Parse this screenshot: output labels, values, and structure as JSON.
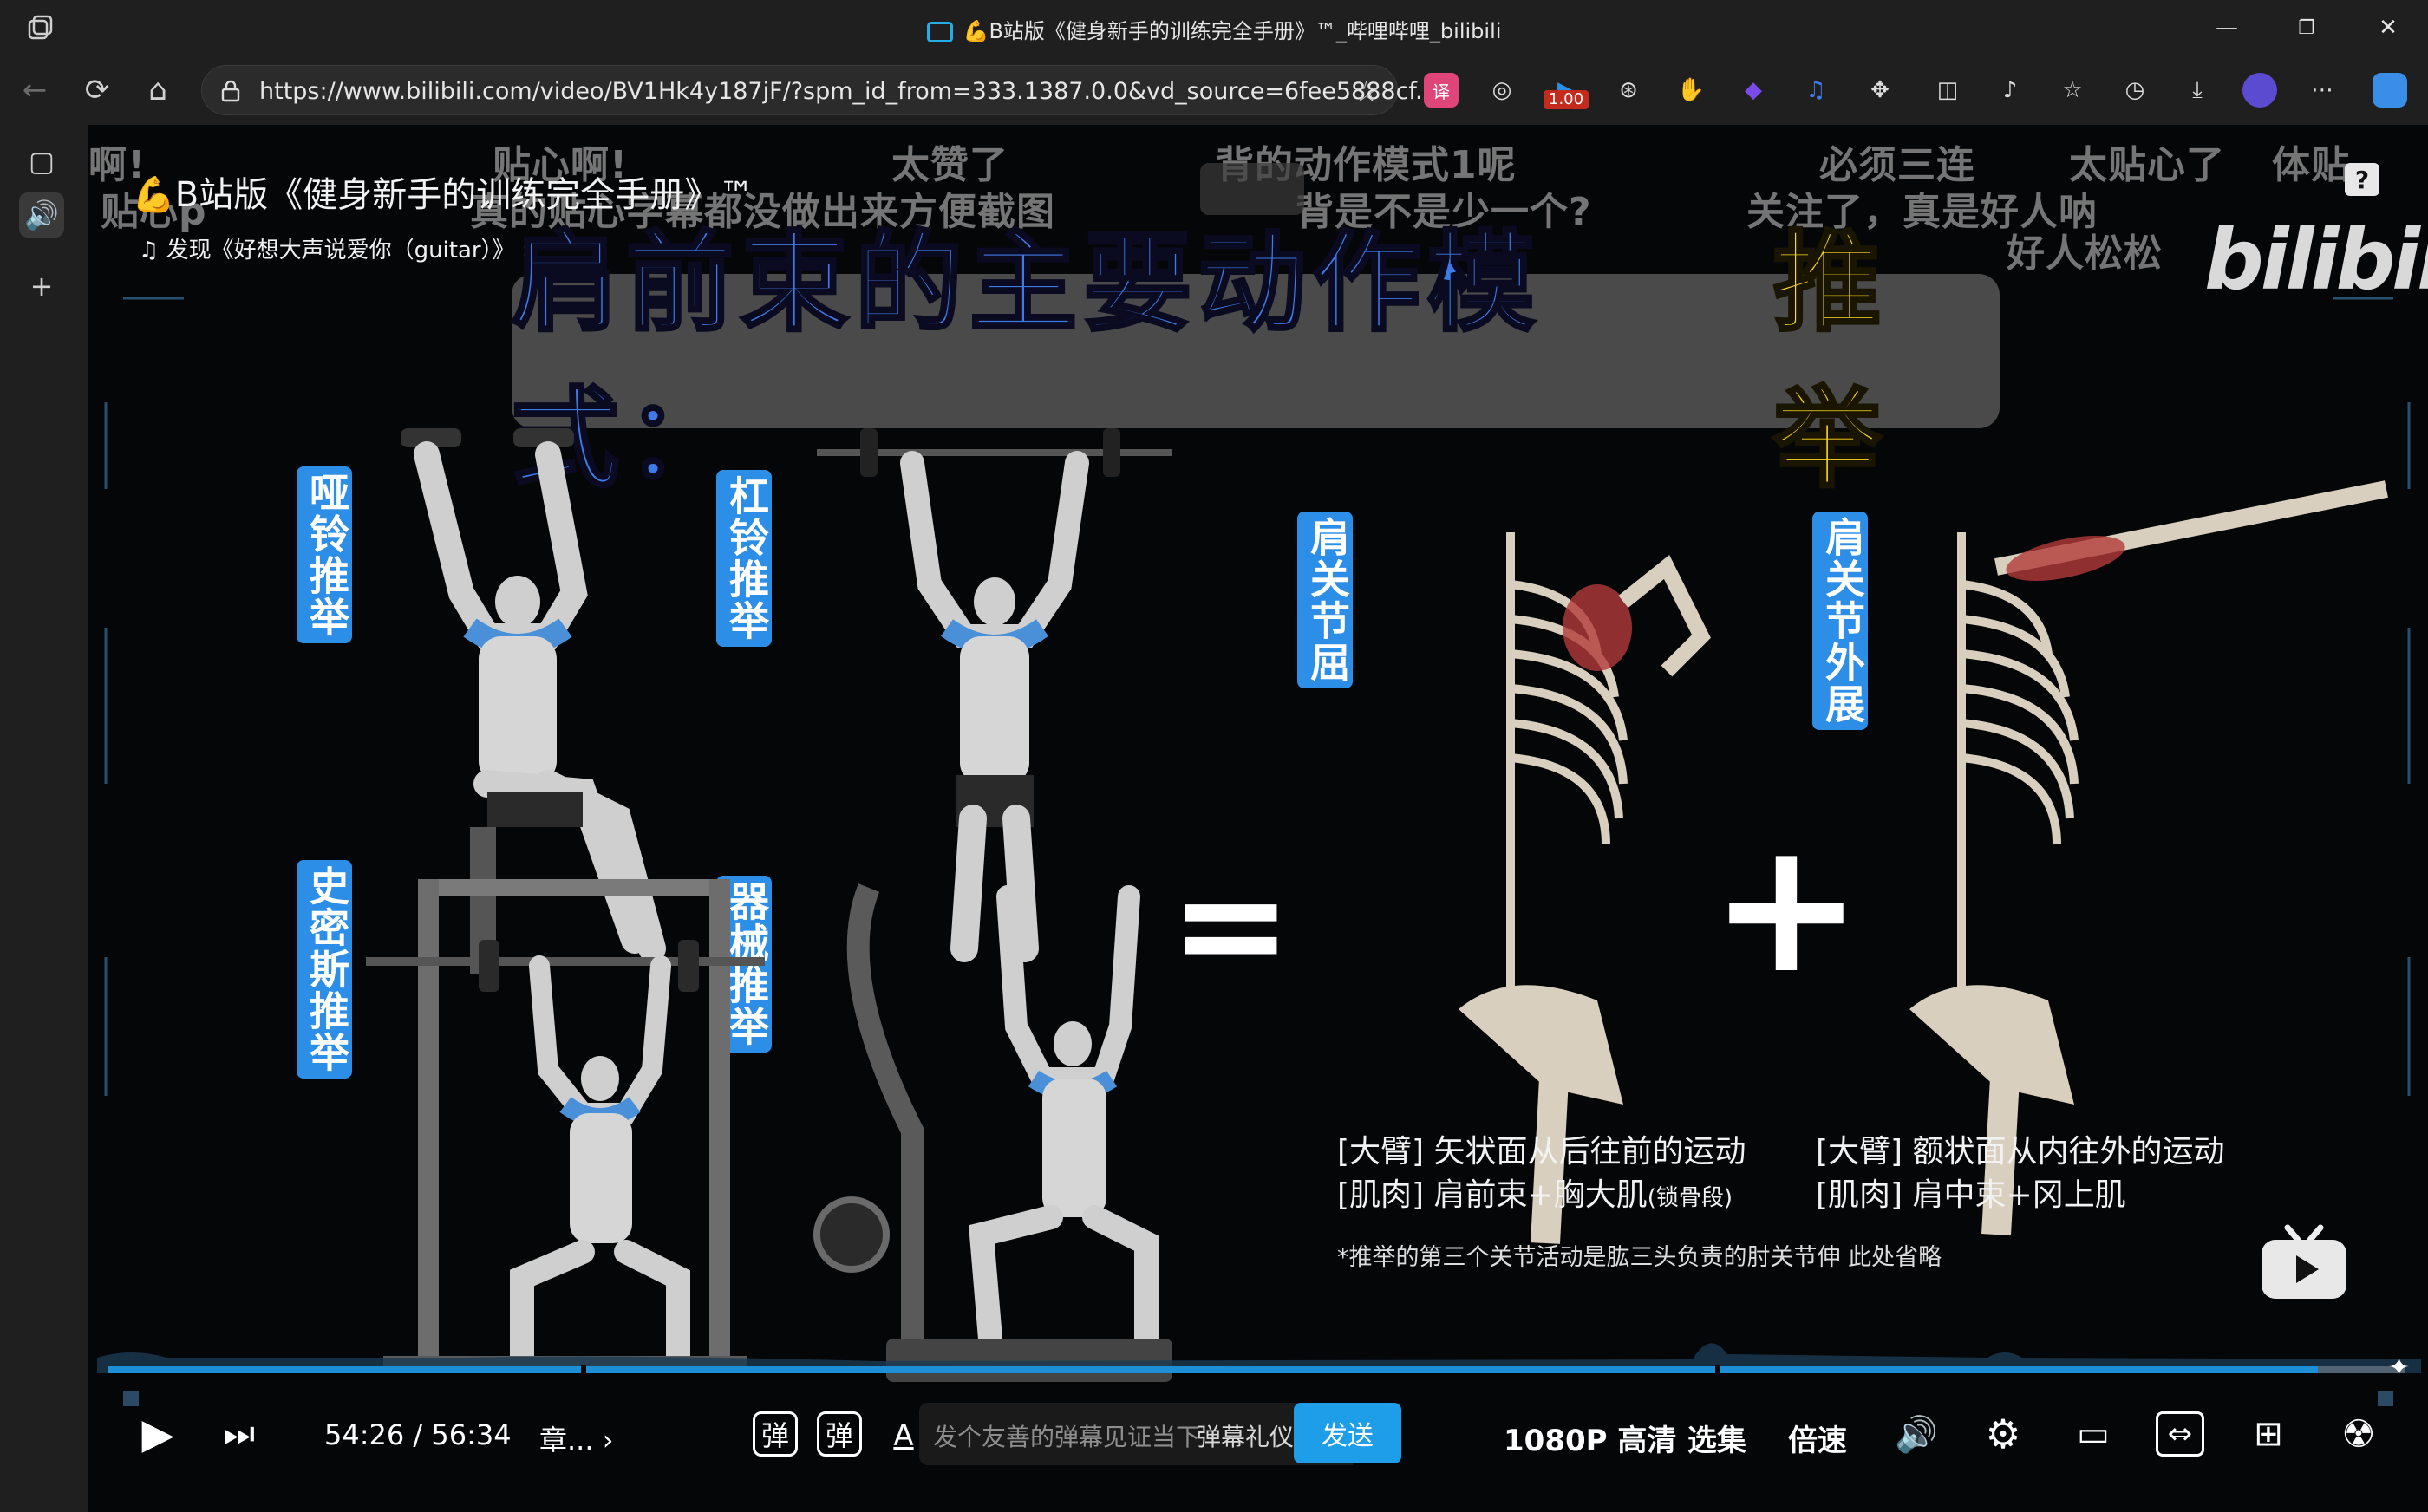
{
  "window": {
    "title": "💪B站版《健身新手的训练完全手册》™_哔哩哔哩_bilibili",
    "minimize": "—",
    "restore": "❐",
    "close": "✕"
  },
  "toolbar": {
    "url": "https://www.bilibili.com/video/BV1Hk4y187jF/?spm_id_from=333.1387.0.0&vd_source=6fee5888cf...",
    "ext_badge": "1.00"
  },
  "video": {
    "title": "💪B站版《健身新手的训练完全手册》™",
    "music": "发现《好想大声说爱你（guitar）》",
    "watermark": "bilibili",
    "help": "?",
    "danmaku": [
      "啊!",
      "贴心啊!",
      "太赞了",
      "背的动作模式1呢",
      "必须三连",
      "太贴心了",
      "体贴",
      "贴心p",
      "真的贴心字幕都没做出来方便截图",
      "背是不是少一个?",
      "关注了，真是好人呐",
      "好人松松"
    ],
    "headline_main": "肩前束的主要动作模式：",
    "headline_accent": "推举",
    "labels": {
      "dumbbell": "哑铃推举",
      "barbell": "杠铃推举",
      "smith": "史密斯推举",
      "machine": "器械推举",
      "flexion": "肩关节屈",
      "abduction": "肩关节外展"
    },
    "equals": "=",
    "plus": "+",
    "desc_left_1": "[大臂] 矢状面从后往前的运动",
    "desc_left_2": "[肌肉] 肩前束+胸大肌",
    "desc_left_2_small": "(锁骨段)",
    "desc_right_1": "[大臂] 额状面从内往外的运动",
    "desc_right_2": "[肌肉] 肩中束+冈上肌",
    "footnote": "*推举的第三个关节活动是肱三头负责的肘关节伸 此处省略"
  },
  "player": {
    "progress": 0.962,
    "time_current": "54:26",
    "time_separator": "/",
    "time_total": "56:34",
    "chapter": "章...",
    "danmaku_placeholder": "发个友善的弹幕见证当下",
    "danmaku_etiquette": "弹幕礼仪 ›",
    "send": "发送",
    "quality": "1080P 高清",
    "episodes": "选集",
    "speed": "倍速"
  },
  "colors": {
    "accent_blue": "#1e9ee8",
    "label_blue": "#2d8ee8",
    "headline_blue": "#3f7be8",
    "headline_yellow": "#ffde1f"
  }
}
